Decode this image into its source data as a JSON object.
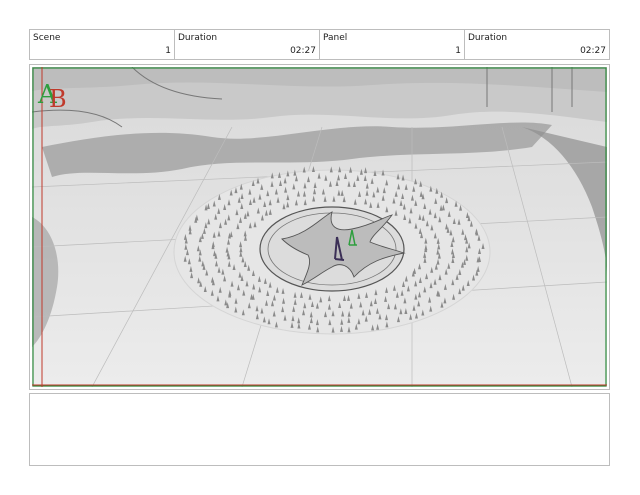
{
  "header": {
    "scene_label": "Scene",
    "scene_value": "1",
    "scene_duration_label": "Duration",
    "scene_duration_value": "02:27",
    "panel_label": "Panel",
    "panel_value": "1",
    "panel_duration_label": "Duration",
    "panel_duration_value": "02:27"
  },
  "panel": {
    "logo_letters": "AB",
    "colors": {
      "frame_red": "#c0392b",
      "frame_green": "#2e8b3d",
      "logo_green": "#2e9e3e",
      "logo_red": "#c0392b"
    }
  },
  "notes": {
    "text": ""
  }
}
